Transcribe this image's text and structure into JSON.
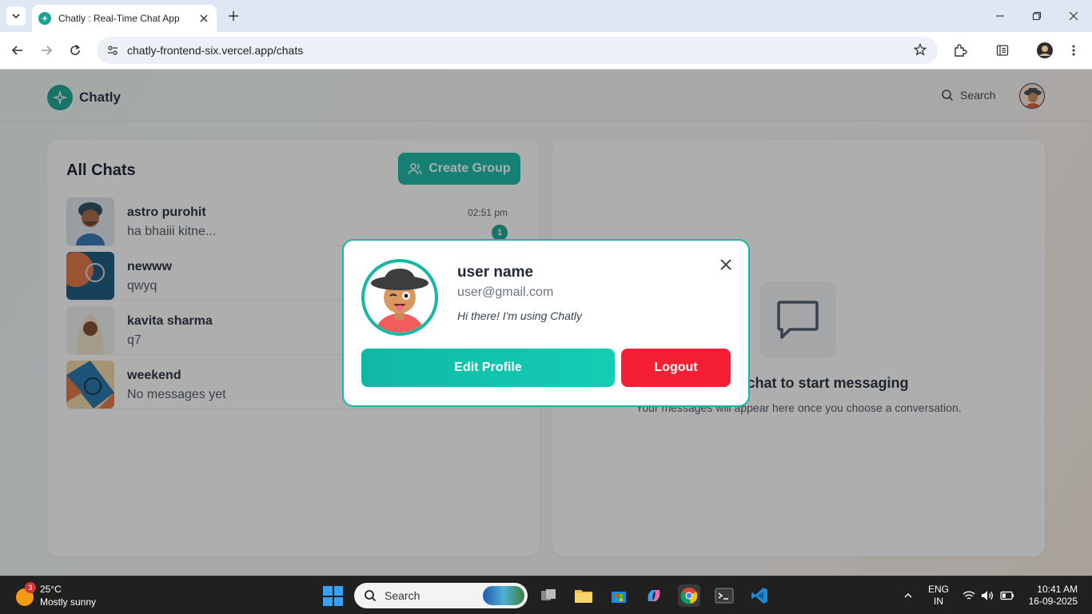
{
  "browser": {
    "tab_title": "Chatly : Real-Time Chat App",
    "url": "chatly-frontend-six.vercel.app/chats"
  },
  "app": {
    "brand": "Chatly",
    "search_label": "Search"
  },
  "chats": {
    "title": "All Chats",
    "create_group_label": "Create Group",
    "items": [
      {
        "name": "astro purohit",
        "last_message": "ha bhaiii kitne...",
        "time": "02:51 pm",
        "unread": "1"
      },
      {
        "name": "newww",
        "last_message": "qwyq"
      },
      {
        "name": "kavita sharma",
        "last_message": "q7"
      },
      {
        "name": "weekend",
        "last_message": "No messages yet"
      }
    ]
  },
  "empty_state": {
    "title": "Select a chat to start messaging",
    "subtitle": "Your messages will appear here once you choose a conversation."
  },
  "profile_modal": {
    "name": "user name",
    "email": "user@gmail.com",
    "bio": "Hi there! I'm using Chatly",
    "edit_label": "Edit Profile",
    "logout_label": "Logout"
  },
  "taskbar": {
    "weather_temp": "25°C",
    "weather_desc": "Mostly sunny",
    "weather_badge": "3",
    "search_label": "Search",
    "lang_1": "ENG",
    "lang_2": "IN",
    "time": "10:41 AM",
    "date": "16-09-2025"
  },
  "colors": {
    "accent": "#14b8a6",
    "logout": "#f51f35"
  }
}
